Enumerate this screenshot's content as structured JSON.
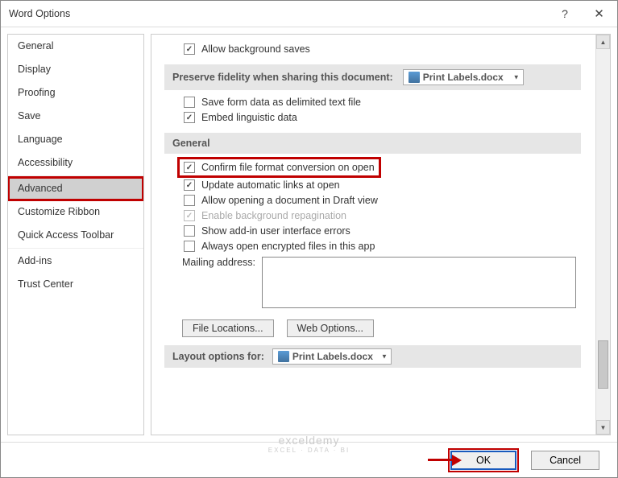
{
  "title": "Word Options",
  "sidebar": {
    "items": [
      {
        "label": "General"
      },
      {
        "label": "Display"
      },
      {
        "label": "Proofing"
      },
      {
        "label": "Save"
      },
      {
        "label": "Language"
      },
      {
        "label": "Accessibility"
      },
      {
        "label": "Advanced"
      },
      {
        "label": "Customize Ribbon"
      },
      {
        "label": "Quick Access Toolbar"
      },
      {
        "label": "Add-ins"
      },
      {
        "label": "Trust Center"
      }
    ]
  },
  "opts": {
    "allow_bg_saves": "Allow background saves",
    "preserve_title": "Preserve fidelity when sharing this document:",
    "preserve_doc": "Print Labels.docx",
    "save_form_data": "Save form data as delimited text file",
    "embed_linguistic": "Embed linguistic data",
    "general_title": "General",
    "confirm_conversion": "Confirm file format conversion on open",
    "update_auto_links": "Update automatic links at open",
    "allow_draft": "Allow opening a document in Draft view",
    "enable_repag": "Enable background repagination",
    "show_addin_errors": "Show add-in user interface errors",
    "always_encrypted": "Always open encrypted files in this app",
    "mailing_label": "Mailing address:",
    "file_locations": "File Locations...",
    "web_options": "Web Options...",
    "layout_title": "Layout options for:",
    "layout_doc": "Print Labels.docx"
  },
  "footer": {
    "ok": "OK",
    "cancel": "Cancel"
  },
  "watermark": {
    "main": "exceldemy",
    "sub": "EXCEL · DATA · BI"
  }
}
